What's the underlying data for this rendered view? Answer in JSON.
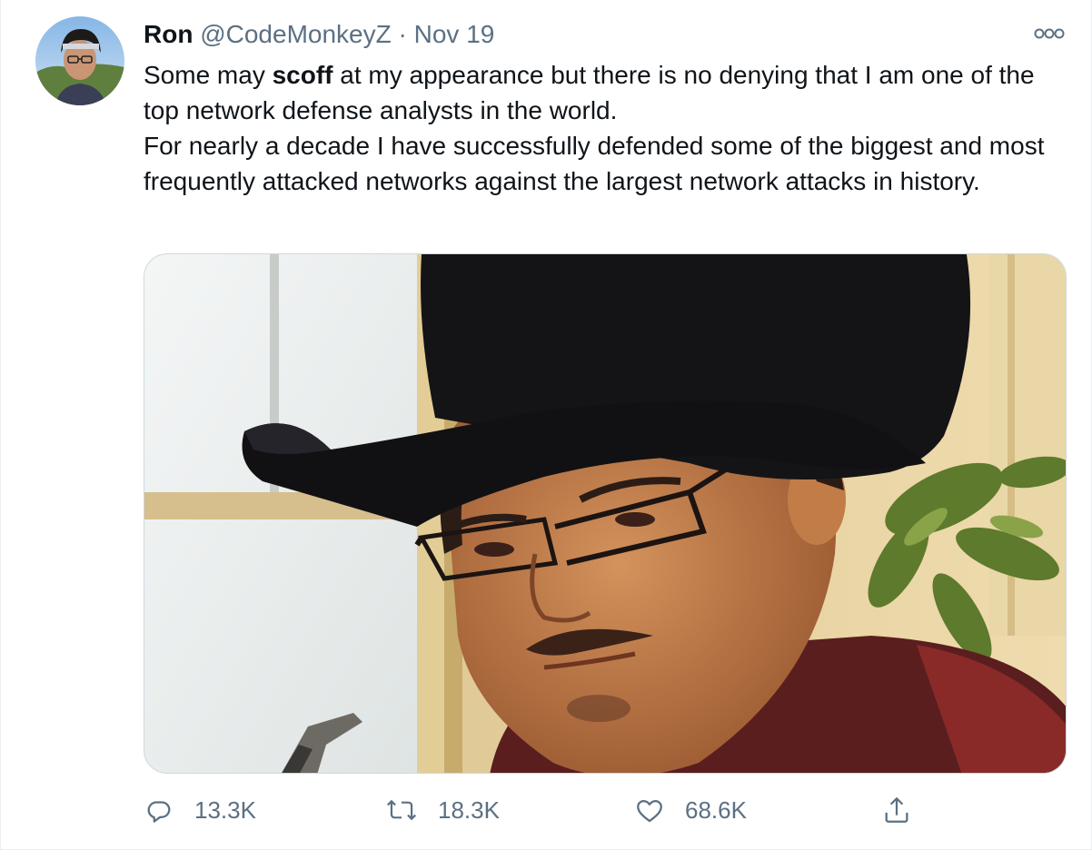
{
  "tweet": {
    "author_name": "Ron",
    "handle": "@CodeMonkeyZ",
    "separator": "·",
    "date": "Nov 19",
    "text_line1_pre": "Some may ",
    "text_line1_bold": "scoff",
    "text_line1_post": " at my appearance but there is no denying that I am one of the top network defense analysts in the world.",
    "text_line2": "For nearly a decade I have successfully defended some of the biggest and most frequently attacked networks against the largest network attacks in history."
  },
  "actions": {
    "replies": "13.3K",
    "retweets": "18.3K",
    "likes": "68.6K"
  },
  "icons": {
    "reply": "reply-icon",
    "retweet": "retweet-icon",
    "like": "heart-icon",
    "share": "share-icon",
    "more": "more-options-icon"
  },
  "colors": {
    "secondary_text": "#5b7083",
    "border": "#cfd9de"
  }
}
